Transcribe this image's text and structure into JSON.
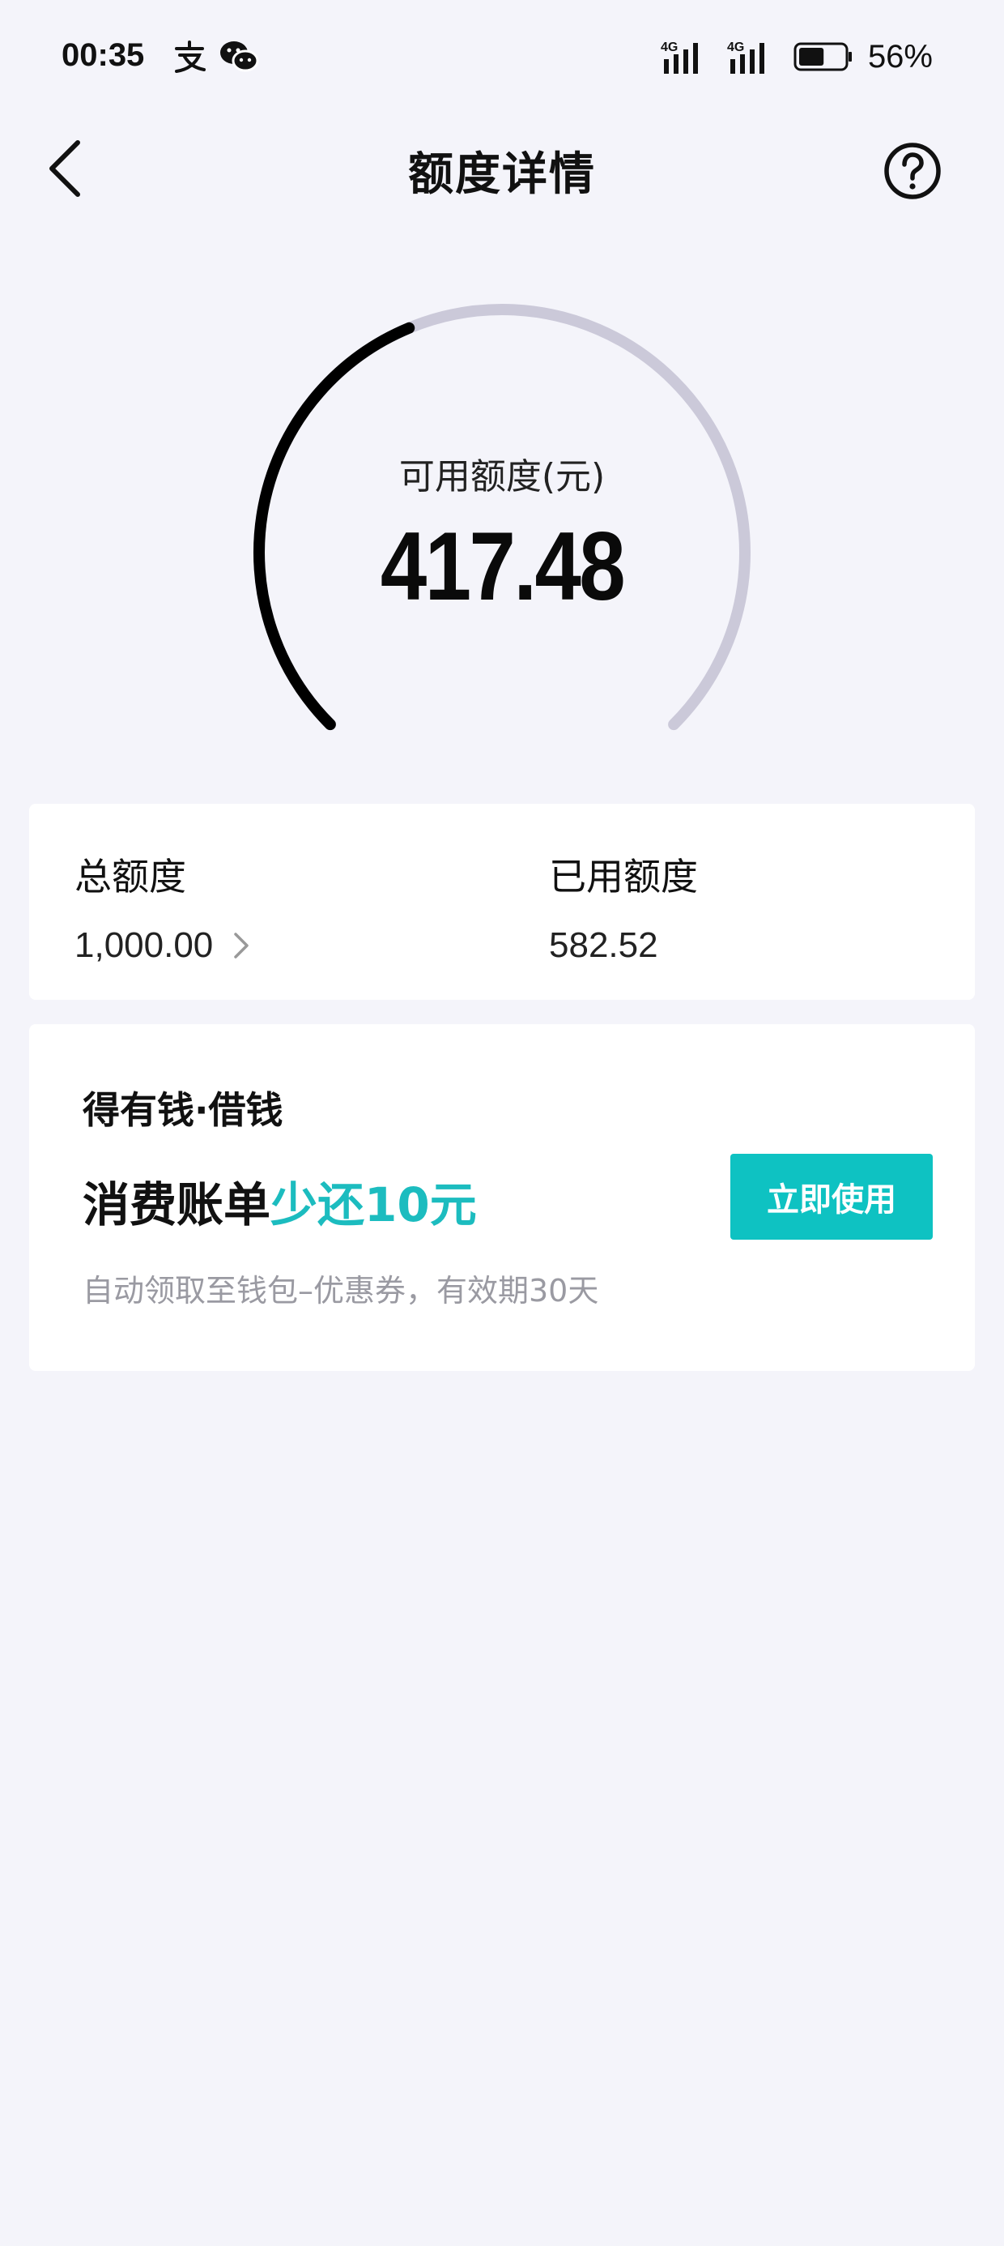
{
  "status_bar": {
    "time": "00:35",
    "app_icons": [
      "alipay-icon",
      "wechat-icon"
    ],
    "signal_labels": [
      "4G",
      "4G"
    ],
    "battery_percent": "56%",
    "battery_level": 0.56
  },
  "nav": {
    "title": "额度详情",
    "back_icon": "chevron-left-icon",
    "help_icon": "question-circle-icon"
  },
  "gauge": {
    "label": "可用额度(元)",
    "value": "417.48",
    "available_fraction": 0.4167,
    "colors": {
      "filled": "#000000",
      "track": "#cbc9d9"
    }
  },
  "limit_card": {
    "total": {
      "label": "总额度",
      "value": "1,000.00"
    },
    "used": {
      "label": "已用额度",
      "value": "582.52"
    }
  },
  "promo_card": {
    "brand": "得有钱·借钱",
    "headline_main": "消费账单",
    "headline_accent": "少还10元",
    "subtitle": "自动领取至钱包–优惠券，有效期30天",
    "button_label": "立即使用",
    "accent_color": "#1cbcbf",
    "button_color": "#0ec2c2"
  }
}
